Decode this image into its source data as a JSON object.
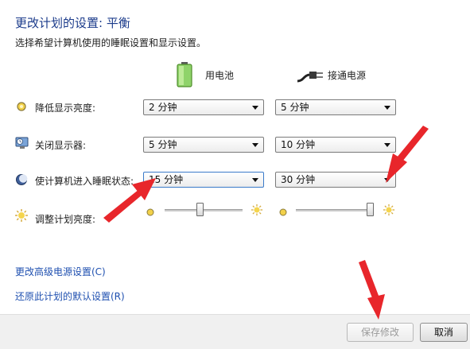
{
  "header": {
    "title": "更改计划的设置: 平衡",
    "subtitle": "选择希望计算机使用的睡眠设置和显示设置。"
  },
  "columns": {
    "battery": "用电池",
    "plugged_in": "接通电源"
  },
  "settings": [
    {
      "label": "降低显示亮度:",
      "battery": "2 分钟",
      "plugged_in": "5 分钟"
    },
    {
      "label": "关闭显示器:",
      "battery": "5 分钟",
      "plugged_in": "10 分钟"
    },
    {
      "label": "使计算机进入睡眠状态:",
      "battery": "15 分钟",
      "plugged_in": "30 分钟"
    }
  ],
  "brightness": {
    "label": "调整计划亮度:",
    "battery_level": 0.45,
    "plugged_in_level": 1.0
  },
  "links": {
    "advanced": "更改高级电源设置(C)",
    "restore": "还原此计划的默认设置(R)"
  },
  "buttons": {
    "save": "保存修改",
    "cancel": "取消"
  },
  "colors": {
    "title": "#1b3b8b",
    "link": "#1f50b0",
    "annotation_arrow": "#e8262b"
  },
  "icons": {
    "battery": "battery-icon",
    "plug": "power-plug-icon",
    "dim": "brightness-dim-icon",
    "display": "display-off-icon",
    "sleep": "sleep-moon-icon",
    "sun": "brightness-sun-icon"
  }
}
